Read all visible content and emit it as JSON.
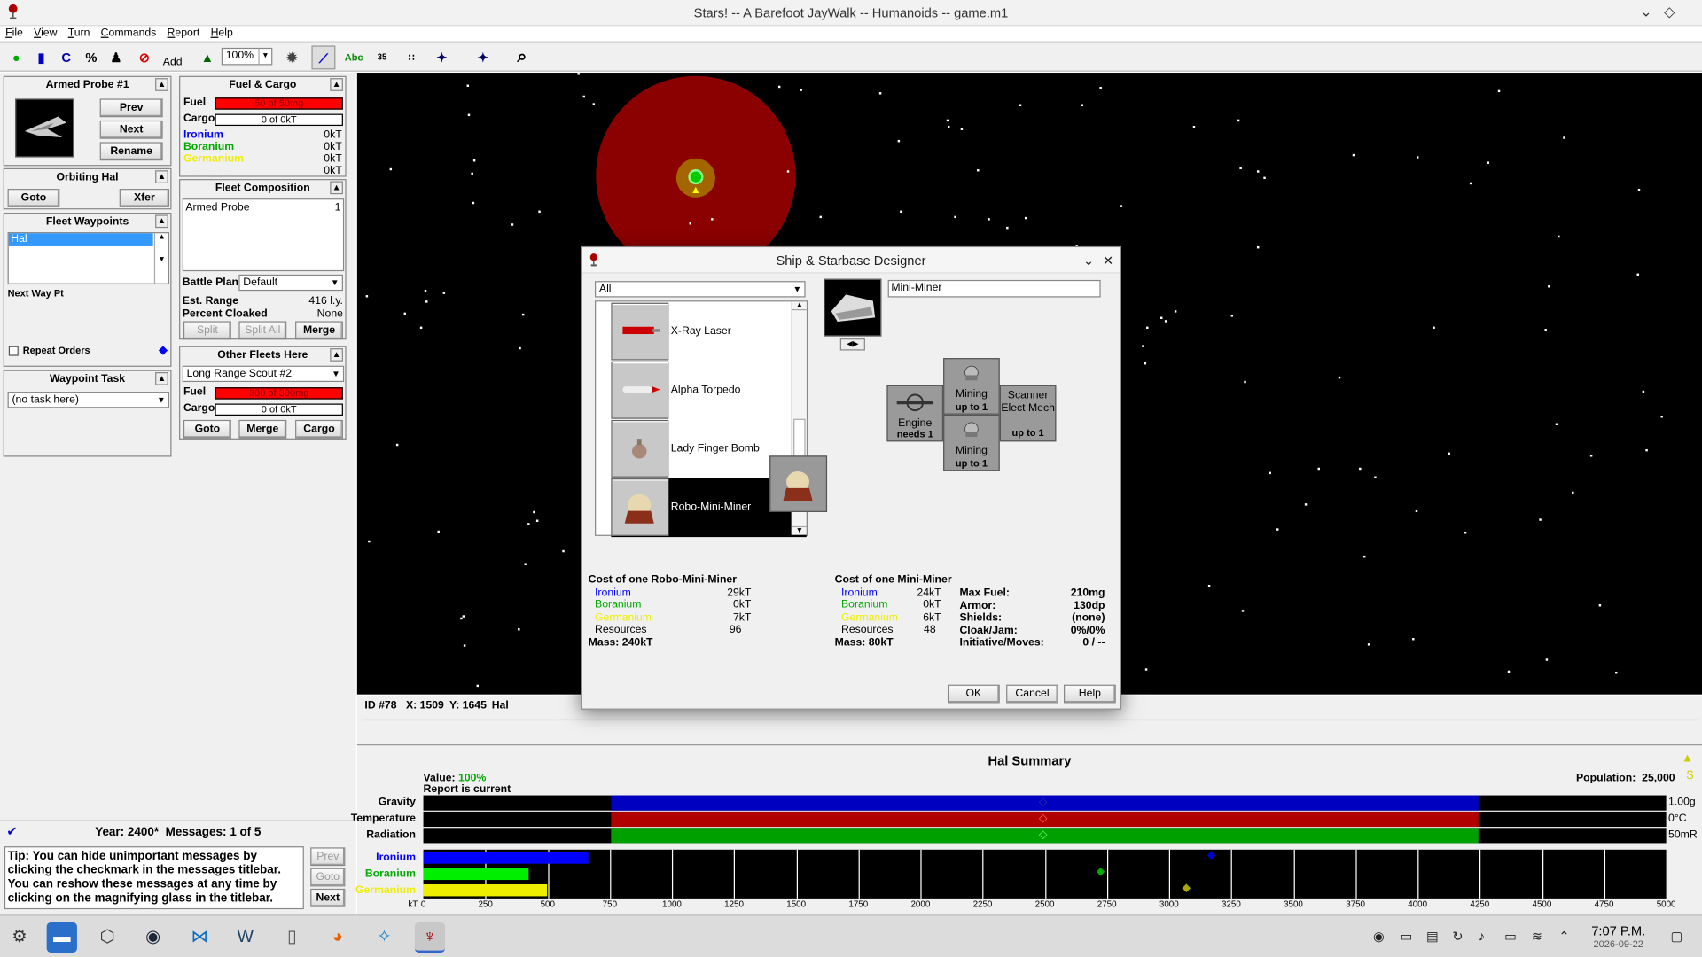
{
  "window": {
    "title": "Stars! -- A Barefoot JayWalk -- Humanoids -- game.m1"
  },
  "menu": [
    "File",
    "View",
    "Turn",
    "Commands",
    "Report",
    "Help"
  ],
  "toolbar": {
    "zoom": "100%",
    "add_label": "Add",
    "scanner_label": "35"
  },
  "fleet": {
    "name": "Armed Probe #1",
    "prev": "Prev",
    "next": "Next",
    "rename": "Rename",
    "orbiting": "Orbiting Hal",
    "goto": "Goto",
    "xfer": "Xfer",
    "waypoints_title": "Fleet Waypoints",
    "waypoint": "Hal",
    "next_waypoint": "Next Way Pt",
    "repeat_orders": "Repeat Orders",
    "waypoint_task_title": "Waypoint Task",
    "waypoint_task": "(no task here)"
  },
  "fuelcargo": {
    "title": "Fuel & Cargo",
    "fuel_label": "Fuel",
    "fuel": "50 of 50mg",
    "cargo_label": "Cargo",
    "cargo": "0 of 0kT",
    "ironium": "Ironium",
    "ironium_val": "0kT",
    "boranium": "Boranium",
    "boranium_val": "0kT",
    "germanium": "Germanium",
    "germanium_val": "0kT",
    "colonists": "Colonists",
    "colonists_val": "0kT"
  },
  "composition": {
    "title": "Fleet Composition",
    "ship": "Armed Probe",
    "count": "1",
    "battle_plan_label": "Battle Plan:",
    "battle_plan": "Default",
    "est_range_label": "Est. Range",
    "est_range": "416 l.y.",
    "cloaked_label": "Percent Cloaked",
    "cloaked": "None",
    "split": "Split",
    "split_all": "Split All",
    "merge": "Merge"
  },
  "otherfleets": {
    "title": "Other Fleets Here",
    "fleet": "Long Range Scout #2",
    "fuel_label": "Fuel",
    "fuel": "300 of 300mg",
    "cargo_label": "Cargo",
    "cargo": "0 of 0kT",
    "goto": "Goto",
    "merge": "Merge",
    "cargo_btn": "Cargo"
  },
  "status": {
    "id": "ID #78",
    "x": "X: 1509",
    "y": "Y: 1645",
    "name": "Hal"
  },
  "summary": {
    "title": "Hal Summary",
    "value_label": "Value:",
    "value": "100%",
    "report": "Report is current",
    "population_label": "Population:",
    "population": "25,000",
    "gravity": "Gravity",
    "gravity_val": "1.00g",
    "temperature": "Temperature",
    "temperature_val": "0°C",
    "radiation": "Radiation",
    "radiation_val": "50mR",
    "ironium": "Ironium",
    "boranium": "Boranium",
    "germanium": "Germanium",
    "kt": "kT",
    "ticks": [
      "0",
      "250",
      "500",
      "750",
      "1000",
      "1250",
      "1500",
      "1750",
      "2000",
      "2250",
      "2500",
      "2750",
      "3000",
      "3250",
      "3500",
      "3750",
      "4000",
      "4250",
      "4500",
      "4750",
      "5000"
    ]
  },
  "messages": {
    "year": "Year: 2400*",
    "count": "Messages: 1 of 5",
    "text": "Tip: You can hide unimportant messages by clicking the checkmark in the messages titlebar. You can reshow these messages at any time by clicking on the magnifying glass in the titlebar.",
    "prev": "Prev",
    "goto": "Goto",
    "next": "Next"
  },
  "designer": {
    "title": "Ship & Starbase Designer",
    "filter": "All",
    "components": [
      "X-Ray Laser",
      "Alpha Torpedo",
      "Lady Finger Bomb",
      "Robo-Mini-Miner"
    ],
    "selected_component": "Robo-Mini-Miner",
    "design_name": "Mini-Miner",
    "slots": {
      "engine": "Engine",
      "engine_sub": "needs 1",
      "mining": "Mining",
      "mining_sub": "up to 1",
      "mining2": "Mining",
      "mining2_sub": "up to 1",
      "scanner": "Scanner Elect Mech",
      "scanner_sub": "up to 1"
    },
    "cost_comp": {
      "title": "Cost of one Robo-Mini-Miner",
      "ironium": "Ironium",
      "ironium_v": "29kT",
      "boranium": "Boranium",
      "boranium_v": "0kT",
      "germanium": "Germanium",
      "germanium_v": "7kT",
      "resources": "Resources",
      "resources_v": "96",
      "mass": "Mass: 240kT"
    },
    "cost_ship": {
      "title": "Cost of one Mini-Miner",
      "ironium": "Ironium",
      "ironium_v": "24kT",
      "boranium": "Boranium",
      "boranium_v": "0kT",
      "germanium": "Germanium",
      "germanium_v": "6kT",
      "resources": "Resources",
      "resources_v": "48",
      "mass": "Mass: 80kT"
    },
    "stats": {
      "max_fuel": "Max Fuel:",
      "max_fuel_v": "210mg",
      "armor": "Armor:",
      "armor_v": "130dp",
      "shields": "Shields:",
      "shields_v": "(none)",
      "cloak": "Cloak/Jam:",
      "cloak_v": "0%/0%",
      "init": "Initiative/Moves:",
      "init_v": "0 / --"
    },
    "ok": "OK",
    "cancel": "Cancel",
    "help": "Help"
  },
  "clock": {
    "time": "7:07 P.M.",
    "date": "2026-09-22"
  },
  "colors": {
    "ironium": "#0000ff",
    "boranium": "#00b000",
    "germanium": "#e0e000",
    "fuel": "#ff0000"
  }
}
